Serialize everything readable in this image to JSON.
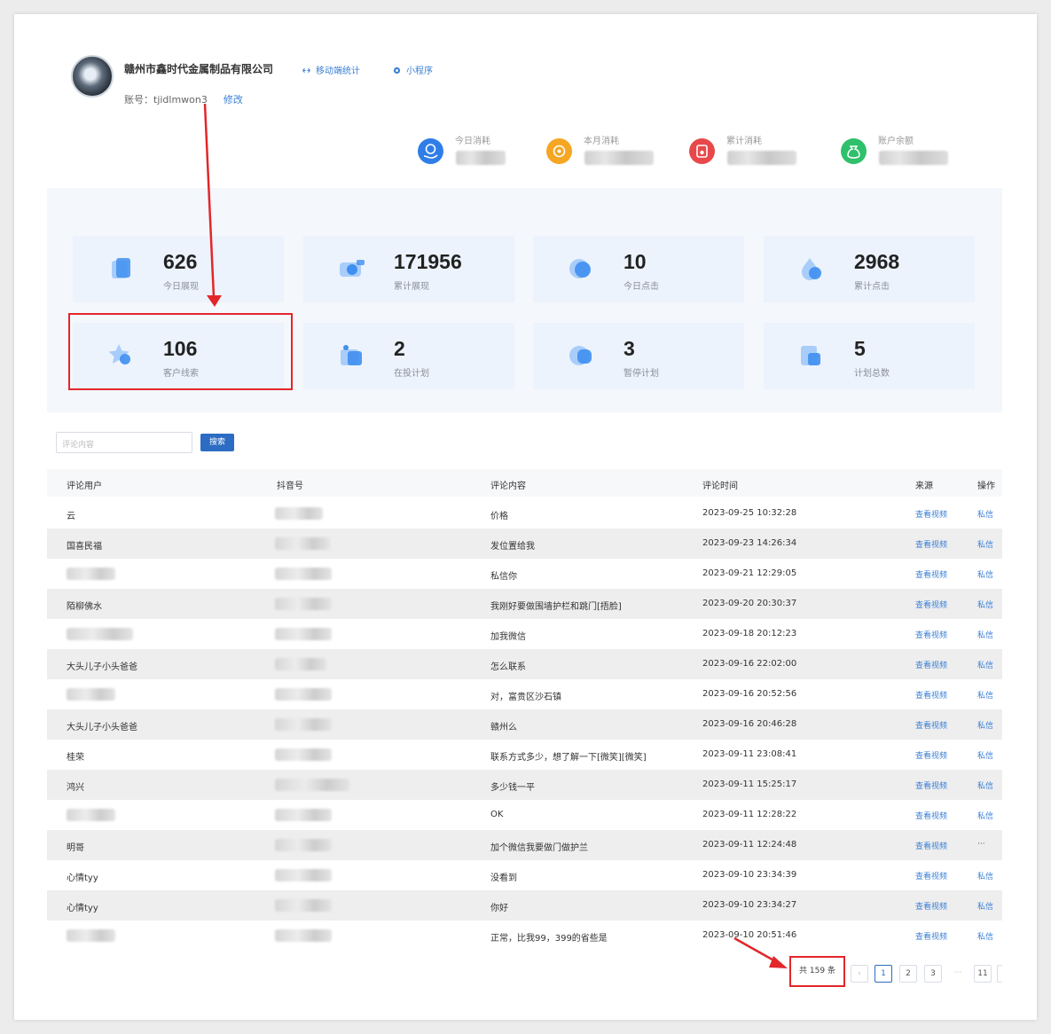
{
  "header": {
    "company_name": "赣州市鑫时代金属制品有限公司",
    "link_mobile_stats": "移动端统计",
    "link_mini_program": "小程序",
    "account_label": "账号：",
    "account_value": "tjidlmwon3",
    "edit_label": "修改",
    "metrics": [
      {
        "label": "今日消耗",
        "icon": "hand-coin-icon",
        "color": "#2f7ee8"
      },
      {
        "label": "本月消耗",
        "icon": "sun-coin-icon",
        "color": "#f5a623"
      },
      {
        "label": "累计消耗",
        "icon": "wallet-icon",
        "color": "#e8484a"
      },
      {
        "label": "账户余额",
        "icon": "money-bag-icon",
        "color": "#2fc06b"
      }
    ]
  },
  "stats": [
    {
      "value": "626",
      "label": "今日展现",
      "icon": "cube-icon"
    },
    {
      "value": "171956",
      "label": "累计展现",
      "icon": "camera-icon"
    },
    {
      "value": "10",
      "label": "今日点击",
      "icon": "cursor-icon"
    },
    {
      "value": "2968",
      "label": "累计点击",
      "icon": "drop-icon"
    },
    {
      "value": "106",
      "label": "客户线索",
      "icon": "star-icon"
    },
    {
      "value": "2",
      "label": "在投计划",
      "icon": "gift-icon"
    },
    {
      "value": "3",
      "label": "暂停计划",
      "icon": "pause-icon"
    },
    {
      "value": "5",
      "label": "计划总数",
      "icon": "folder-icon"
    }
  ],
  "search": {
    "placeholder": "评论内容",
    "button_label": "搜索"
  },
  "table": {
    "columns": [
      "评论用户",
      "抖音号",
      "评论内容",
      "评论时间",
      "来源",
      "操作"
    ],
    "rows": [
      {
        "user": "云",
        "content": "价格",
        "time": "2023-09-25 10:32:28",
        "source": "查看视频",
        "action": "私信"
      },
      {
        "user": "国喜民福",
        "content": "发位置给我",
        "time": "2023-09-23 14:26:34",
        "source": "查看视频",
        "action": "私信"
      },
      {
        "user": "",
        "content": "私信你",
        "time": "2023-09-21 12:29:05",
        "source": "查看视频",
        "action": "私信"
      },
      {
        "user": "陌柳佛水",
        "content": "我刚好要做围墙护栏和跳门[捂脸]",
        "time": "2023-09-20 20:30:37",
        "source": "查看视频",
        "action": "私信"
      },
      {
        "user": "",
        "content": "加我微信",
        "time": "2023-09-18 20:12:23",
        "source": "查看视频",
        "action": "私信"
      },
      {
        "user": "大头儿子小头爸爸",
        "content": "怎么联系",
        "time": "2023-09-16 22:02:00",
        "source": "查看视频",
        "action": "私信"
      },
      {
        "user": "",
        "content": "对，富贵区沙石镇",
        "time": "2023-09-16 20:52:56",
        "source": "查看视频",
        "action": "私信"
      },
      {
        "user": "大头儿子小头爸爸",
        "content": "赣州么",
        "time": "2023-09-16 20:46:28",
        "source": "查看视频",
        "action": "私信"
      },
      {
        "user": "桂荣",
        "content": "联系方式多少，想了解一下[微笑][微笑]",
        "time": "2023-09-11 23:08:41",
        "source": "查看视频",
        "action": "私信"
      },
      {
        "user": "鸿兴",
        "content": "多少钱一平",
        "time": "2023-09-11 15:25:17",
        "source": "查看视频",
        "action": "私信"
      },
      {
        "user": "",
        "content": "OK",
        "time": "2023-09-11 12:28:22",
        "source": "查看视频",
        "action": "私信"
      },
      {
        "user": "明哥",
        "content": "加个微信我要做门做护兰",
        "time": "2023-09-11 12:24:48",
        "source": "查看视频",
        "action": "···"
      },
      {
        "user": "心情tyy",
        "content": "没看到",
        "time": "2023-09-10 23:34:39",
        "source": "查看视频",
        "action": "私信"
      },
      {
        "user": "心情tyy",
        "content": "你好",
        "time": "2023-09-10 23:34:27",
        "source": "查看视频",
        "action": "私信"
      },
      {
        "user": "",
        "content": "正常，比我99，399的省些是",
        "time": "2023-09-10 20:51:46",
        "source": "查看视频",
        "action": "私信"
      }
    ]
  },
  "pagination": {
    "total": "共 159 条",
    "prev": "‹",
    "pages": [
      "1",
      "2",
      "3"
    ],
    "ellipsis": "···",
    "last": "11"
  },
  "accent_colors": {
    "primary": "#2c6cc3",
    "link": "#3a7fd5",
    "highlight": "#e3262a"
  }
}
